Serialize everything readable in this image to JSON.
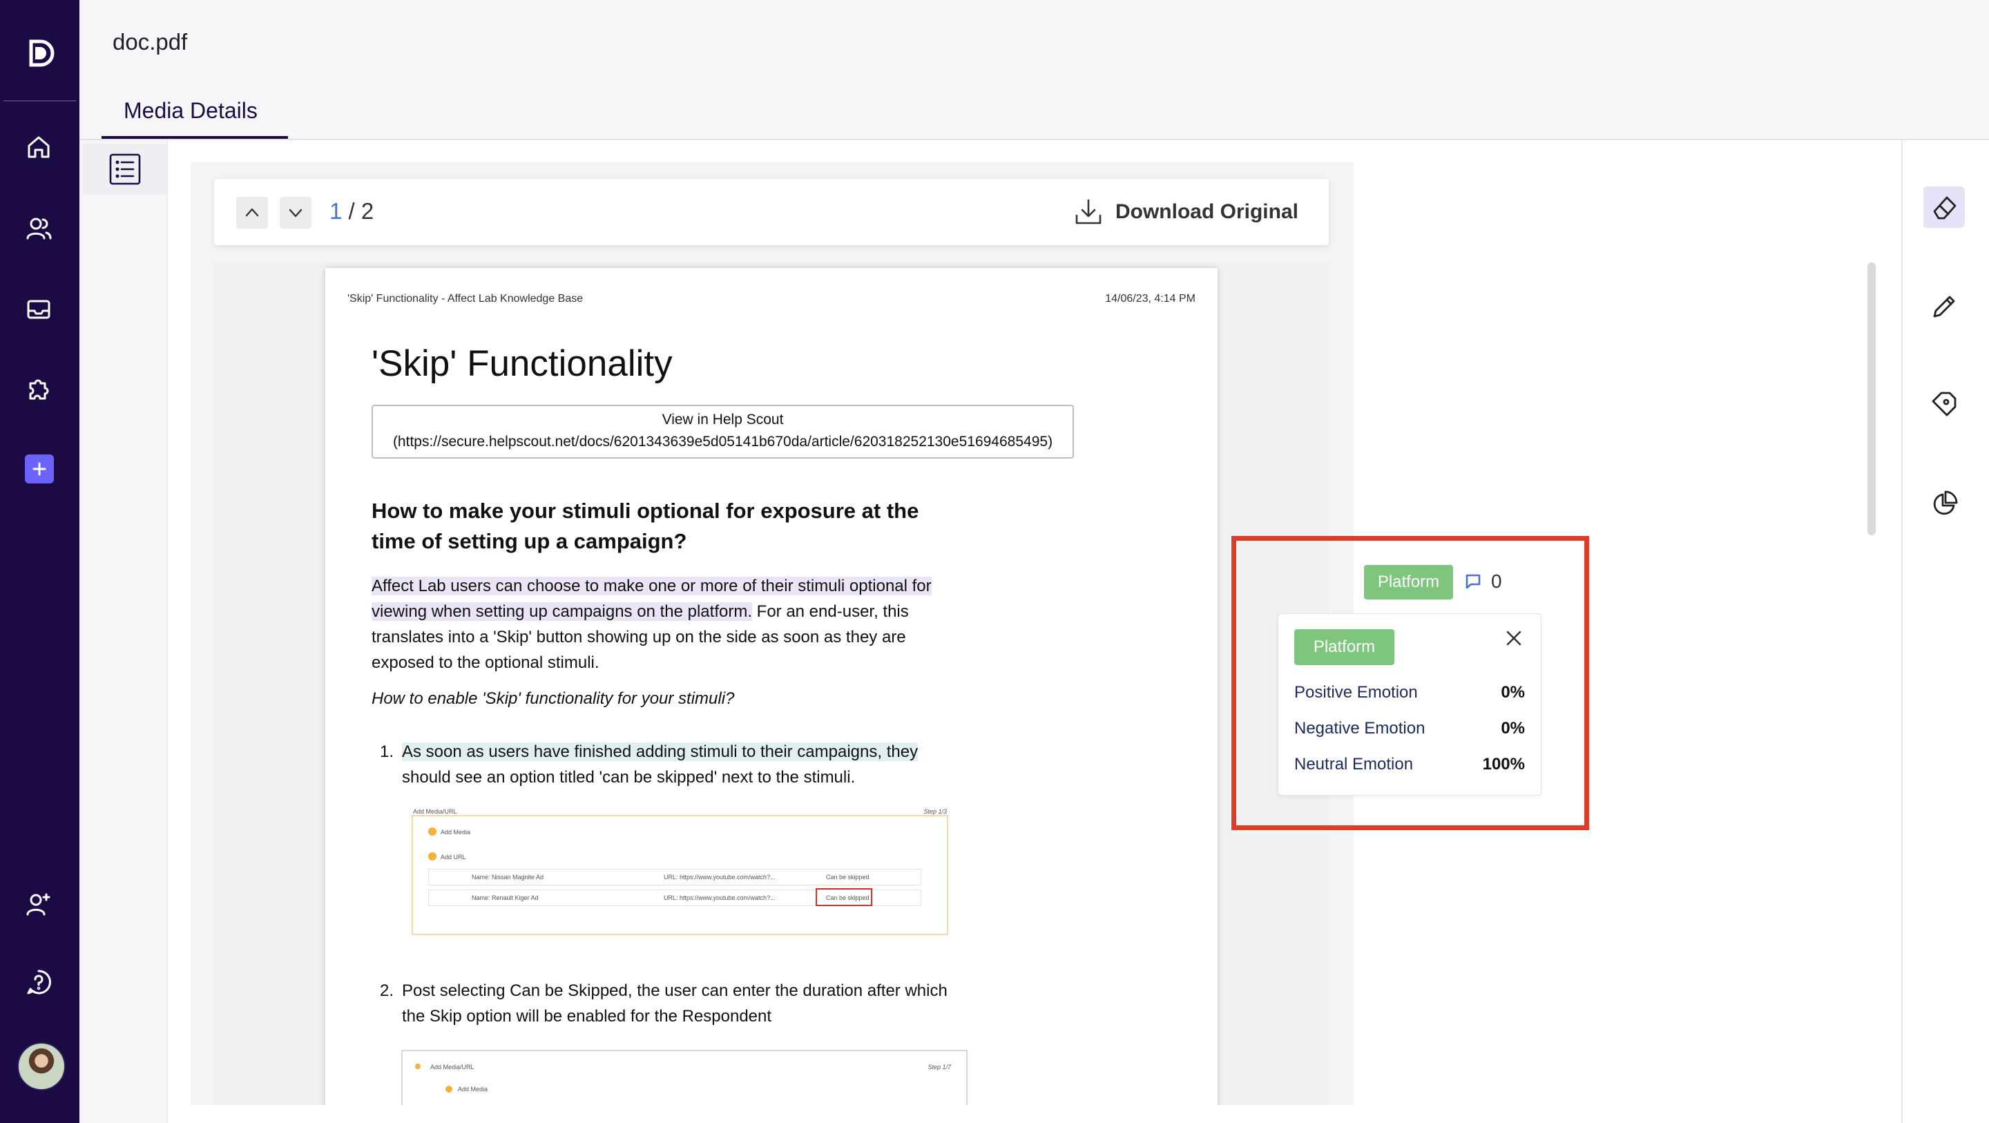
{
  "app": {
    "logo_letter": "D"
  },
  "header": {
    "file_name": "doc.pdf",
    "tab_label": "Media Details"
  },
  "nav": {
    "items": [
      "home-icon",
      "users-icon",
      "inbox-icon",
      "puzzle-icon",
      "plus-icon",
      "add-user-icon",
      "help-icon",
      "avatar"
    ]
  },
  "toolbar": {
    "current_page": "1",
    "page_separator": " / ",
    "total_pages": "2",
    "download_label": "Download Original"
  },
  "document": {
    "header_left": "'Skip' Functionality - Affect Lab Knowledge Base",
    "header_right": "14/06/23, 4:14 PM",
    "title": "'Skip' Functionality",
    "help_box_line1": "View in Help Scout",
    "help_box_line2": "(https://secure.helpscout.net/docs/6201343639e5d05141b670da/article/620318252130e51694685495)",
    "heading": "How to make your stimuli optional for exposure at the time of setting up a campaign?",
    "para_highlight": "Affect Lab users can choose to make one or more of their stimuli optional for viewing when setting up campaigns on the platform.",
    "para_rest": " For an end-user, this translates into a 'Skip' button showing up on the side as soon as they are exposed to the optional stimuli.",
    "italic_question": "How to enable 'Skip' functionality for your stimuli?",
    "step1_num": "1.",
    "step1_highlight": "As soon as users have finished adding stimuli to their campaigns, they",
    "step1_rest": " should see an option titled 'can be skipped' next to the stimuli.",
    "step2_num": "2.",
    "step2_text": "Post selecting Can be Skipped, the user can enter the duration after which the Skip option will be enabled for the Respondent",
    "shot1": {
      "title": "Add Media/URL",
      "step": "Step 1/3",
      "add_media": "Add Media",
      "add_url": "Add URL",
      "row1_name": "Name: Nissan Magnite Ad",
      "row1_url": "URL: https://www.youtube.com/watch?...",
      "row1_opt": "Can be skipped",
      "row2_name": "Name: Renault Kiger Ad",
      "row2_url": "URL: https://www.youtube.com/watch?...",
      "row2_opt": "Can be skipped"
    },
    "shot2": {
      "title": "Add Media/URL",
      "step": "Step 1/7",
      "add_media": "Add Media"
    }
  },
  "annotation": {
    "tag": "Platform",
    "comment_count": "0",
    "card_tag": "Platform",
    "emotions": [
      {
        "label": "Positive Emotion",
        "value": "0%"
      },
      {
        "label": "Negative Emotion",
        "value": "0%"
      },
      {
        "label": "Neutral Emotion",
        "value": "100%"
      }
    ]
  },
  "right_panel": {
    "tools": [
      "eraser-icon",
      "pen-icon",
      "tag-icon",
      "pie-chart-icon"
    ],
    "active": "eraser-icon"
  },
  "colors": {
    "nav_bg": "#1c0a45",
    "accent": "#6c63ff",
    "tag_green": "#7ec57e",
    "annotation_frame": "#e03c2a",
    "page_number": "#4a6fd8"
  }
}
